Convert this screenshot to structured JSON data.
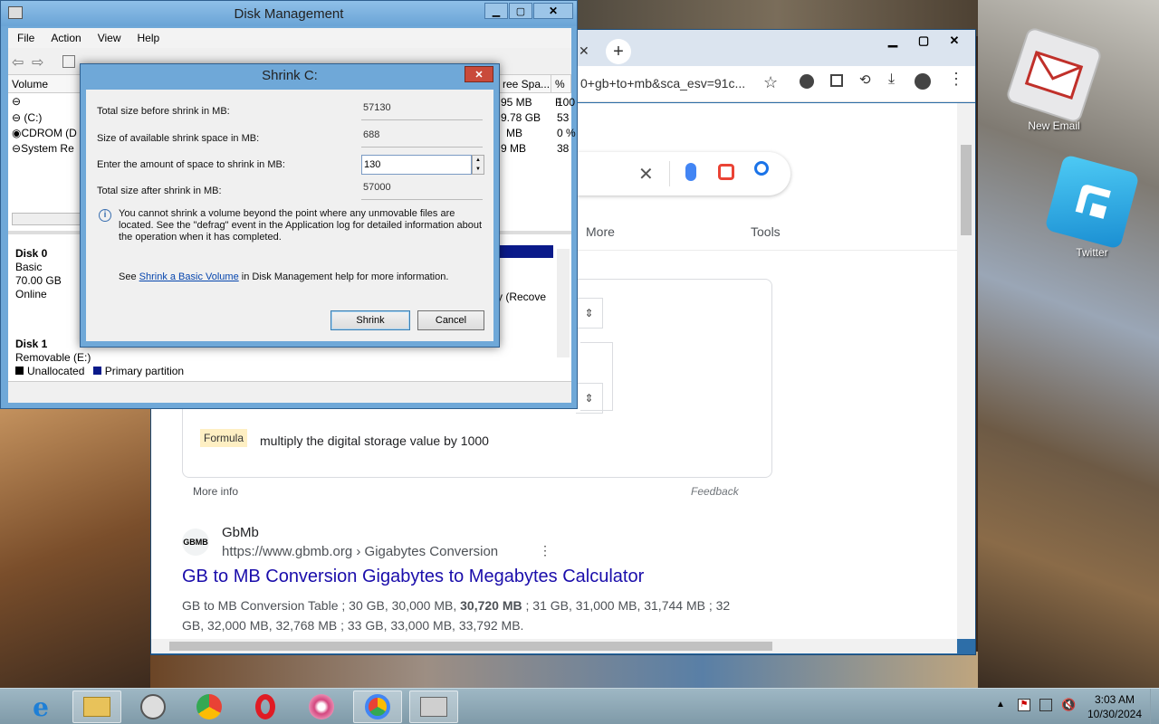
{
  "desktop": {
    "icons": [
      {
        "label": "New Email"
      },
      {
        "label": "Twitter"
      }
    ]
  },
  "chrome": {
    "url": "0+gb+to+mb&sca_esv=91c...",
    "tabs": {
      "more": "More",
      "tools": "Tools"
    },
    "formula_badge": "Formula",
    "formula_text": "multiply the digital storage value by 1000",
    "more_info": "More info",
    "feedback": "Feedback",
    "result": {
      "favicon_text": "GBMB",
      "site_name": "GbMb",
      "site_url": "https://www.gbmb.org › Gigabytes Conversion",
      "title": "GB to MB Conversion Gigabytes to Megabytes Calculator",
      "snippet_a": "GB to MB Conversion Table ; 30 GB, 30,000 MB, ",
      "snippet_bold": "30,720 MB",
      "snippet_b": " ; 31 GB, 31,000 MB, 31,744 MB ; 32 GB, 32,000 MB, 32,768 MB ; 33 GB, 33,000 MB, 33,792 MB."
    }
  },
  "disk_mgmt": {
    "title": "Disk Management",
    "menu": [
      "File",
      "Action",
      "View",
      "Help"
    ],
    "columns": {
      "volume": "Volume",
      "free_space": "ree Spa...",
      "pct_free": "% F"
    },
    "volumes": [
      {
        "name": "",
        "free": "95 MB",
        "pct": "100"
      },
      {
        "name": "(C:)",
        "free": "9.78 GB",
        "pct": "53"
      },
      {
        "name": "CDROM (D",
        "free": "MB",
        "pct": "0 %"
      },
      {
        "name": "System Re",
        "free": "9 MB",
        "pct": "38"
      }
    ],
    "disk0": {
      "name": "Disk 0",
      "type": "Basic",
      "size": "70.00 GB",
      "status": "Online",
      "partition_tail": "y (Recove"
    },
    "disk1": {
      "name": "Disk 1",
      "type": "Removable (E:)"
    },
    "legend": {
      "unallocated": "Unallocated",
      "primary": "Primary partition"
    }
  },
  "shrink_dialog": {
    "title": "Shrink C:",
    "fields": {
      "total_before_label": "Total size before shrink in MB:",
      "total_before_value": "57130",
      "available_label": "Size of available shrink space in MB:",
      "available_value": "688",
      "amount_label": "Enter the amount of space to shrink in MB:",
      "amount_value": "130",
      "total_after_label": "Total size after shrink in MB:",
      "total_after_value": "57000"
    },
    "info_text": "You cannot shrink a volume beyond the point where any unmovable files are located. See the \"defrag\" event in the Application log for detailed information about the operation when it has completed.",
    "help_prefix": "See ",
    "help_link": "Shrink a Basic Volume",
    "help_suffix": " in Disk Management help for more information.",
    "shrink_button": "Shrink",
    "cancel_button": "Cancel"
  },
  "taskbar": {
    "apps": [
      "internet-explorer",
      "file-explorer",
      "media-player",
      "chromium",
      "opera",
      "flower-app",
      "chrome",
      "disk-management"
    ],
    "time": "3:03 AM",
    "date": "10/30/2024"
  }
}
